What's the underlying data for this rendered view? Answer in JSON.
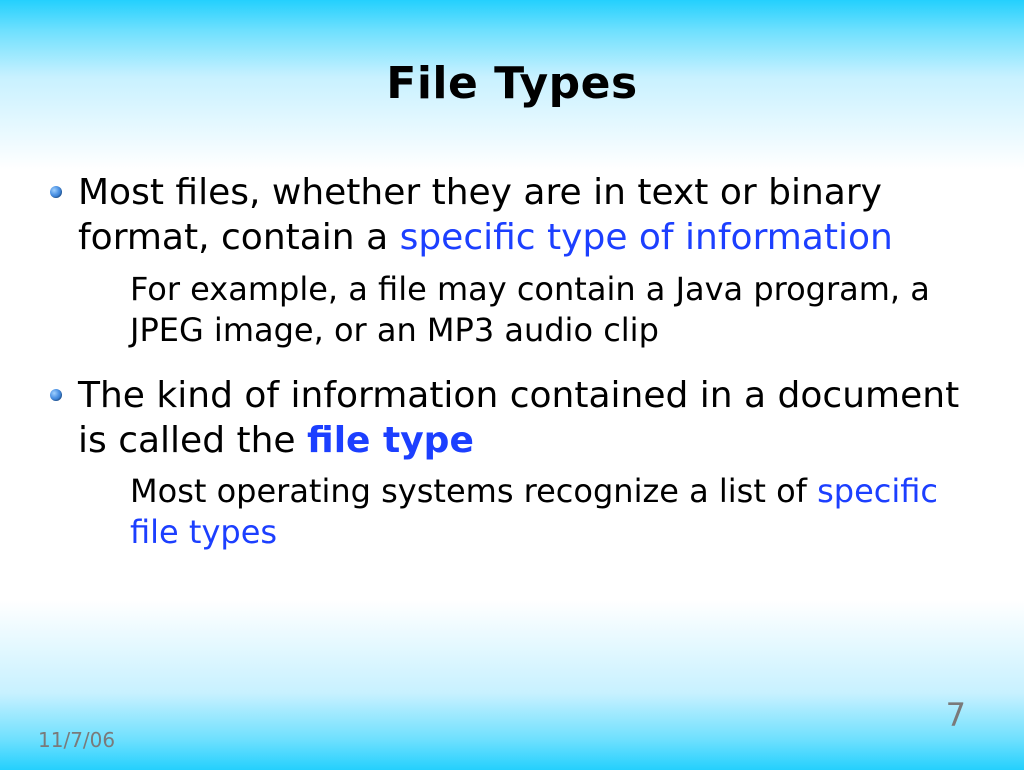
{
  "title": "File Types",
  "bullets": [
    {
      "main_pre": "Most files, whether they are in text or binary format, contain a ",
      "main_hl": "specific type of information",
      "main_hl_class": "hl",
      "main_post": "",
      "sub_pre": "For example, a file may contain a Java program, a JPEG image, or an MP3 audio clip",
      "sub_hl": "",
      "sub_hl_class": "",
      "sub_post": ""
    },
    {
      "main_pre": "The kind of information contained in a document is called the ",
      "main_hl": "file type",
      "main_hl_class": "hl-bold",
      "main_post": "",
      "sub_pre": "Most operating systems recognize a list of ",
      "sub_hl": "specific file types",
      "sub_hl_class": "hl",
      "sub_post": ""
    }
  ],
  "footer": {
    "date": "11/7/06",
    "page": "7"
  }
}
